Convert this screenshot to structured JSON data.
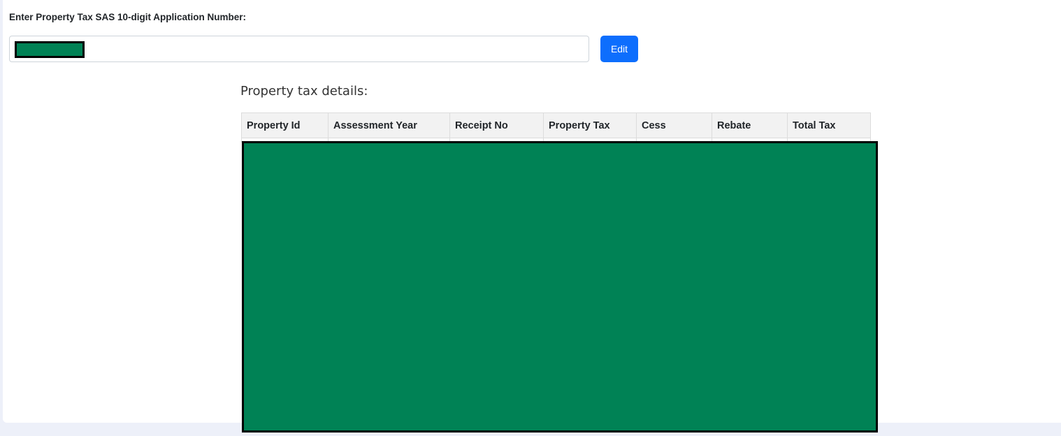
{
  "form": {
    "label": "Enter Property Tax SAS 10-digit Application Number:",
    "input_value": "",
    "edit_label": "Edit"
  },
  "details": {
    "title": "Property tax details:",
    "columns": [
      "Property Id",
      "Assessment Year",
      "Receipt No",
      "Property Tax",
      "Cess",
      "Rebate",
      "Total Tax"
    ]
  },
  "colors": {
    "primary_button": "#0d6efd",
    "redaction_fill": "#008255",
    "redaction_border": "#000000",
    "page_background": "#edf0f9"
  }
}
